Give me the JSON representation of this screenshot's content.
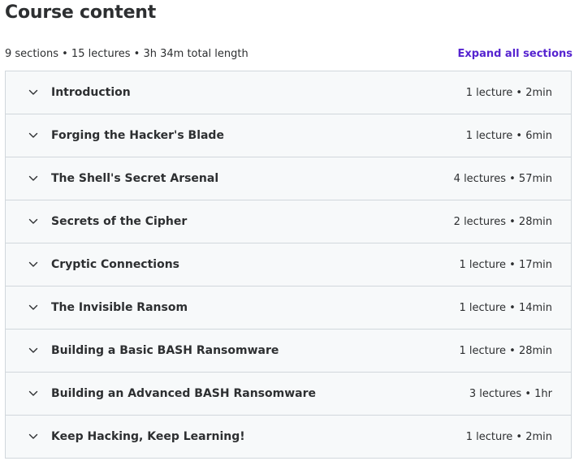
{
  "header": {
    "title": "Course content",
    "summary": "9 sections • 15 lectures • 3h 34m total length",
    "expand_all_label": "Expand all sections",
    "accent_color": "#5624d0"
  },
  "sections": [
    {
      "title": "Introduction",
      "meta": "1 lecture • 2min"
    },
    {
      "title": "Forging the Hacker's Blade",
      "meta": "1 lecture • 6min"
    },
    {
      "title": "The Shell's Secret Arsenal",
      "meta": "4 lectures • 57min"
    },
    {
      "title": "Secrets of the Cipher",
      "meta": "2 lectures • 28min"
    },
    {
      "title": "Cryptic Connections",
      "meta": "1 lecture • 17min"
    },
    {
      "title": "The Invisible Ransom",
      "meta": "1 lecture • 14min"
    },
    {
      "title": "Building a Basic BASH Ransomware",
      "meta": "1 lecture • 28min"
    },
    {
      "title": "Building an Advanced BASH Ransomware",
      "meta": "3 lectures • 1hr"
    },
    {
      "title": "Keep Hacking, Keep Learning!",
      "meta": "1 lecture • 2min"
    }
  ],
  "icons": {
    "section_toggle": "chevron-down-icon"
  }
}
